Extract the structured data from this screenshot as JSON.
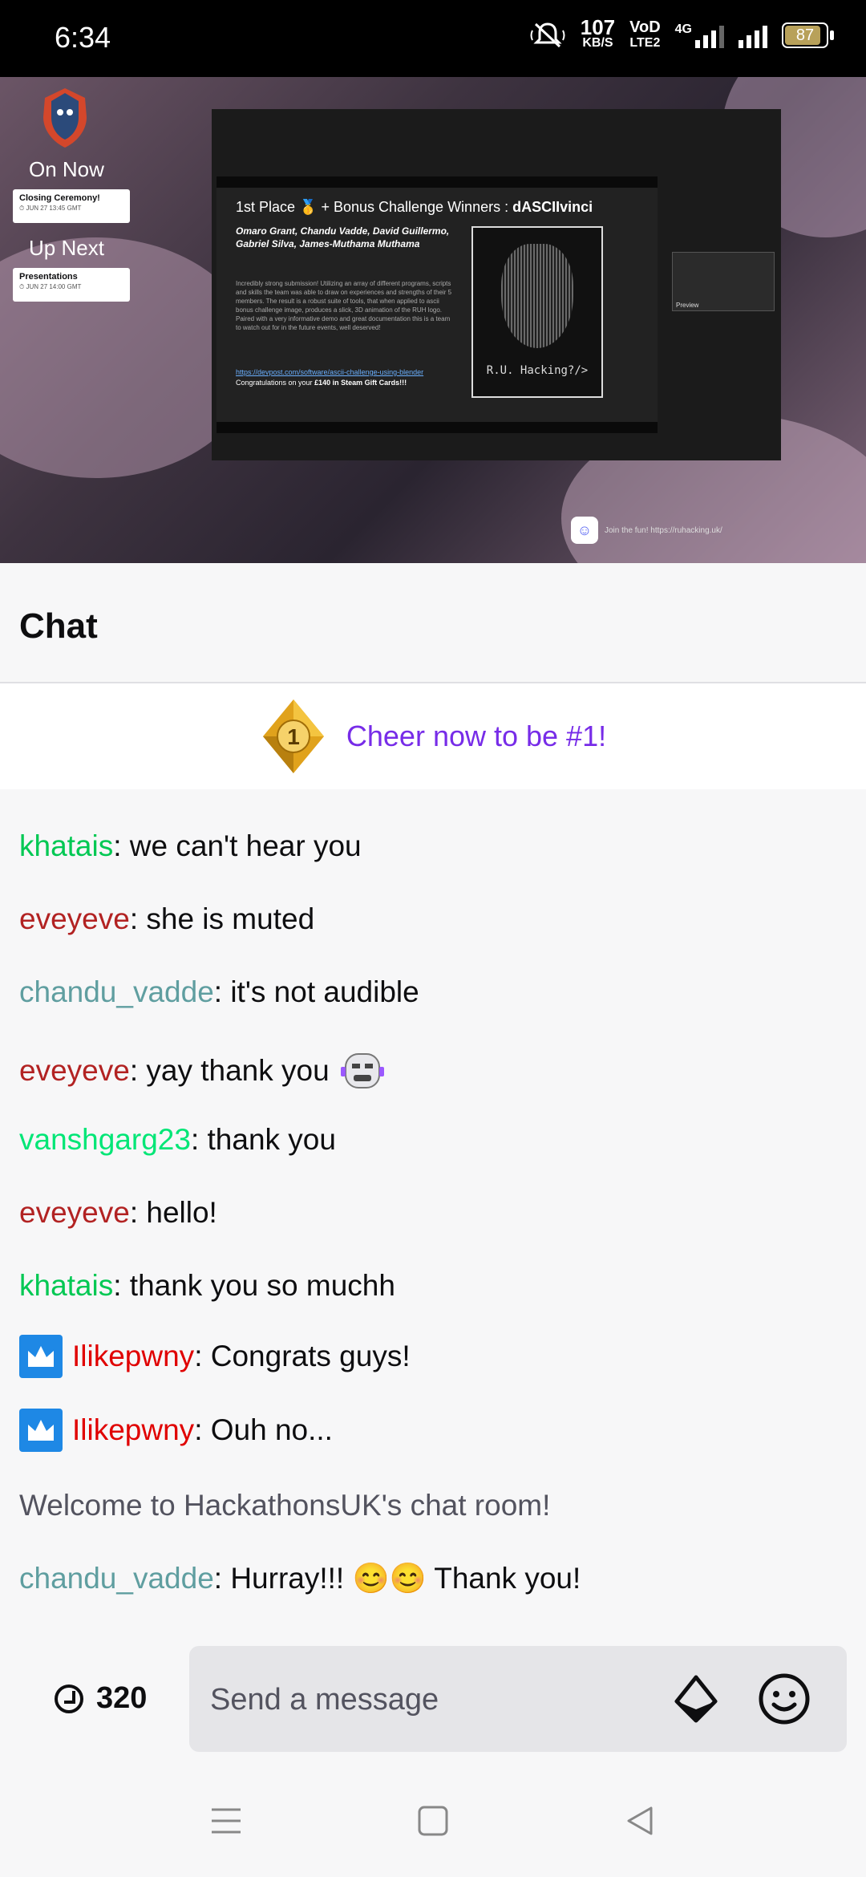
{
  "status_bar": {
    "time": "6:34",
    "net_speed": "107",
    "net_unit": "KB/S",
    "volte": "VoD",
    "volte_sub": "LTE2",
    "network_type": "4G",
    "battery_level": "87"
  },
  "stream": {
    "on_now_label": "On Now",
    "up_next_label": "Up Next",
    "on_now_item": {
      "title": "Closing Ceremony!",
      "time": "⏱ JUN 27 13:45 GMT"
    },
    "up_next_item": {
      "title": "Presentations",
      "time": "⏱ JUN 27 14:00 GMT"
    },
    "slide": {
      "title_prefix": "1st Place 🥇 + Bonus Challenge Winners : ",
      "title_team": "dASCIIvinci",
      "names": "Omaro Grant, Chandu Vadde, David Guillermo, Gabriel Silva, James-Muthama Muthama",
      "body": "Incredibly strong submission! Utilizing an array of different programs, scripts and skills the team was able to draw on experiences and strengths of their 5 members. The result is a robust suite of tools, that when applied to ascii bonus challenge image, produces a slick, 3D animation of the RUH logo. Paired with a very informative demo and great documentation this is a team to watch out for in the future events, well deserved!",
      "link": "https://devpost.com/software/ascii-challenge-using-blender",
      "congrats_prefix": "Congratulations on your ",
      "congrats_prize": "£140 in Steam Gift Cards!!!",
      "ascii_text": "R.U. Hacking?/>"
    },
    "preview_label": "Preview",
    "discord_text": "Join the fun! https://ruhacking.uk/"
  },
  "chat": {
    "title": "Chat",
    "cheer_text": "Cheer now to be #1!",
    "messages": [
      {
        "user": "khatais",
        "color": "#00c853",
        "text": ": we can't hear you"
      },
      {
        "user": "eveyeve",
        "color": "#b22222",
        "text": ": she is muted"
      },
      {
        "user": "chandu_vadde",
        "color": "#5f9ea0",
        "text": ": it's not audible"
      },
      {
        "user": "eveyeve",
        "color": "#b22222",
        "text": ": yay thank you"
      },
      {
        "user": "vanshgarg23",
        "color": "#00e676",
        "text": ": thank you"
      },
      {
        "user": "eveyeve",
        "color": "#b22222",
        "text": ": hello!"
      },
      {
        "user": "khatais",
        "color": "#00c853",
        "text": ": thank you so muchh"
      },
      {
        "user": "Ilikepwny",
        "color": "#e00000",
        "text": ": Congrats guys!"
      },
      {
        "user": "Ilikepwny",
        "color": "#e00000",
        "text": ": Ouh no..."
      },
      {
        "user": "",
        "color": "#53535f",
        "text": "Welcome to HackathonsUK's chat room!"
      },
      {
        "user": "chandu_vadde",
        "color": "#5f9ea0",
        "text": ": Hurray!!! 😊😊 Thank you!"
      }
    ]
  },
  "input": {
    "points": "320",
    "placeholder": "Send a message"
  },
  "icons": {
    "bits": "bits-icon",
    "emote": "emote-smiley-icon",
    "points": "channel-points-icon",
    "badge": "crown-badge-icon"
  }
}
